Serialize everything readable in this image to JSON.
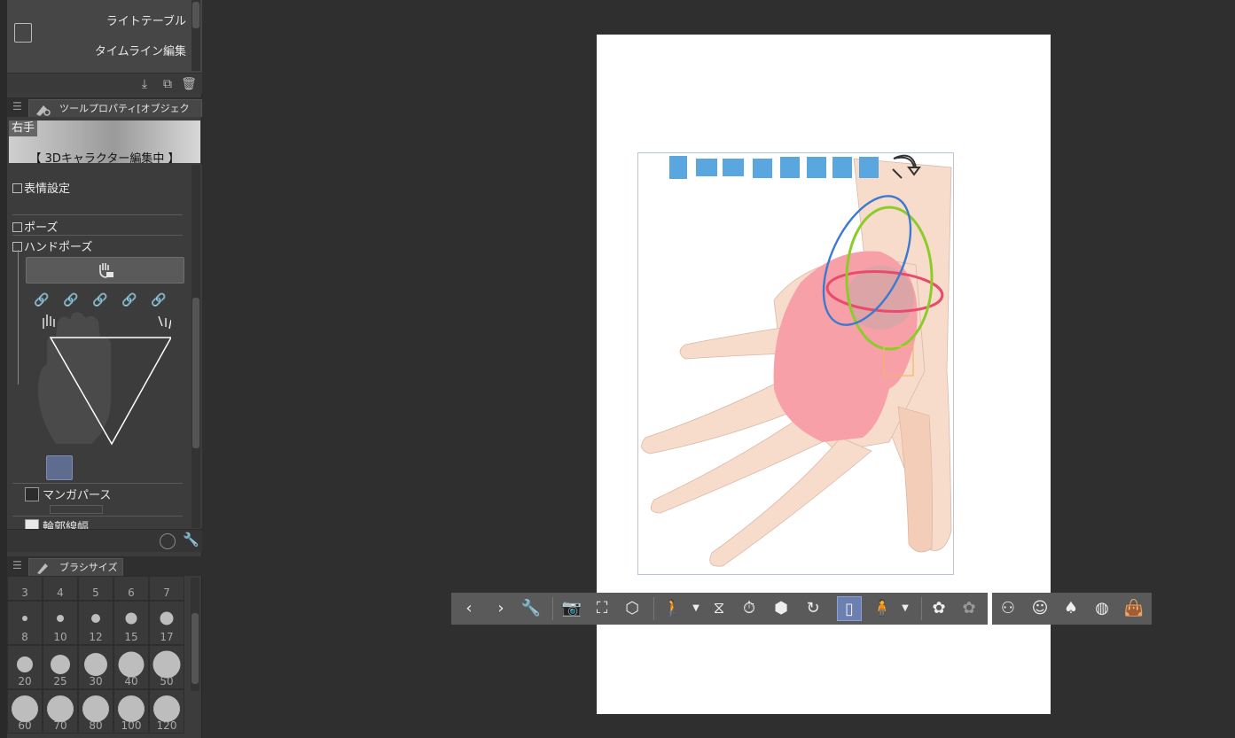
{
  "dock": {
    "list_items": [
      {
        "label": "ライトテーブル"
      },
      {
        "label": "タイムライン編集"
      }
    ],
    "tool_property": {
      "tab_label": "ツールプロパティ[オブジェクト]",
      "object_name": "右手",
      "status": "【 3Dキャラクター編集中 】",
      "categories": {
        "expression": "表情設定",
        "pose": "ポーズ",
        "hand_pose": "ハンドポーズ"
      },
      "checkboxes": {
        "manga_perspective": "マンガパース",
        "outline_width": "輪郭線幅"
      }
    },
    "brush_size": {
      "tab_label": "ブラシサイズ",
      "sizes": [
        "3",
        "4",
        "5",
        "6",
        "7",
        "8",
        "10",
        "12",
        "15",
        "17",
        "20",
        "25",
        "30",
        "40",
        "50",
        "60",
        "70",
        "80",
        "100",
        "120"
      ]
    }
  },
  "colors": {
    "background": "#2f2f2f",
    "panel": "#3c3c3c",
    "paper": "#ffffff",
    "skin": "#f7d9c4",
    "highlight": "#f7a0a8",
    "selection": "#6b7fb0"
  },
  "toolbar": {
    "icons": [
      "prev-icon",
      "next-icon",
      "wrench-icon",
      "camera-icon",
      "fit-icon",
      "ground-icon",
      "add-pose-icon",
      "flip-icon",
      "timer-icon",
      "object-rotate-icon",
      "reset-icon",
      "perspective-icon",
      "figure-icon",
      "lighting-icon",
      "lighting-off-icon"
    ],
    "icons2": [
      "body-icon",
      "face-icon",
      "hair-icon",
      "head-icon",
      "bag-icon"
    ]
  }
}
